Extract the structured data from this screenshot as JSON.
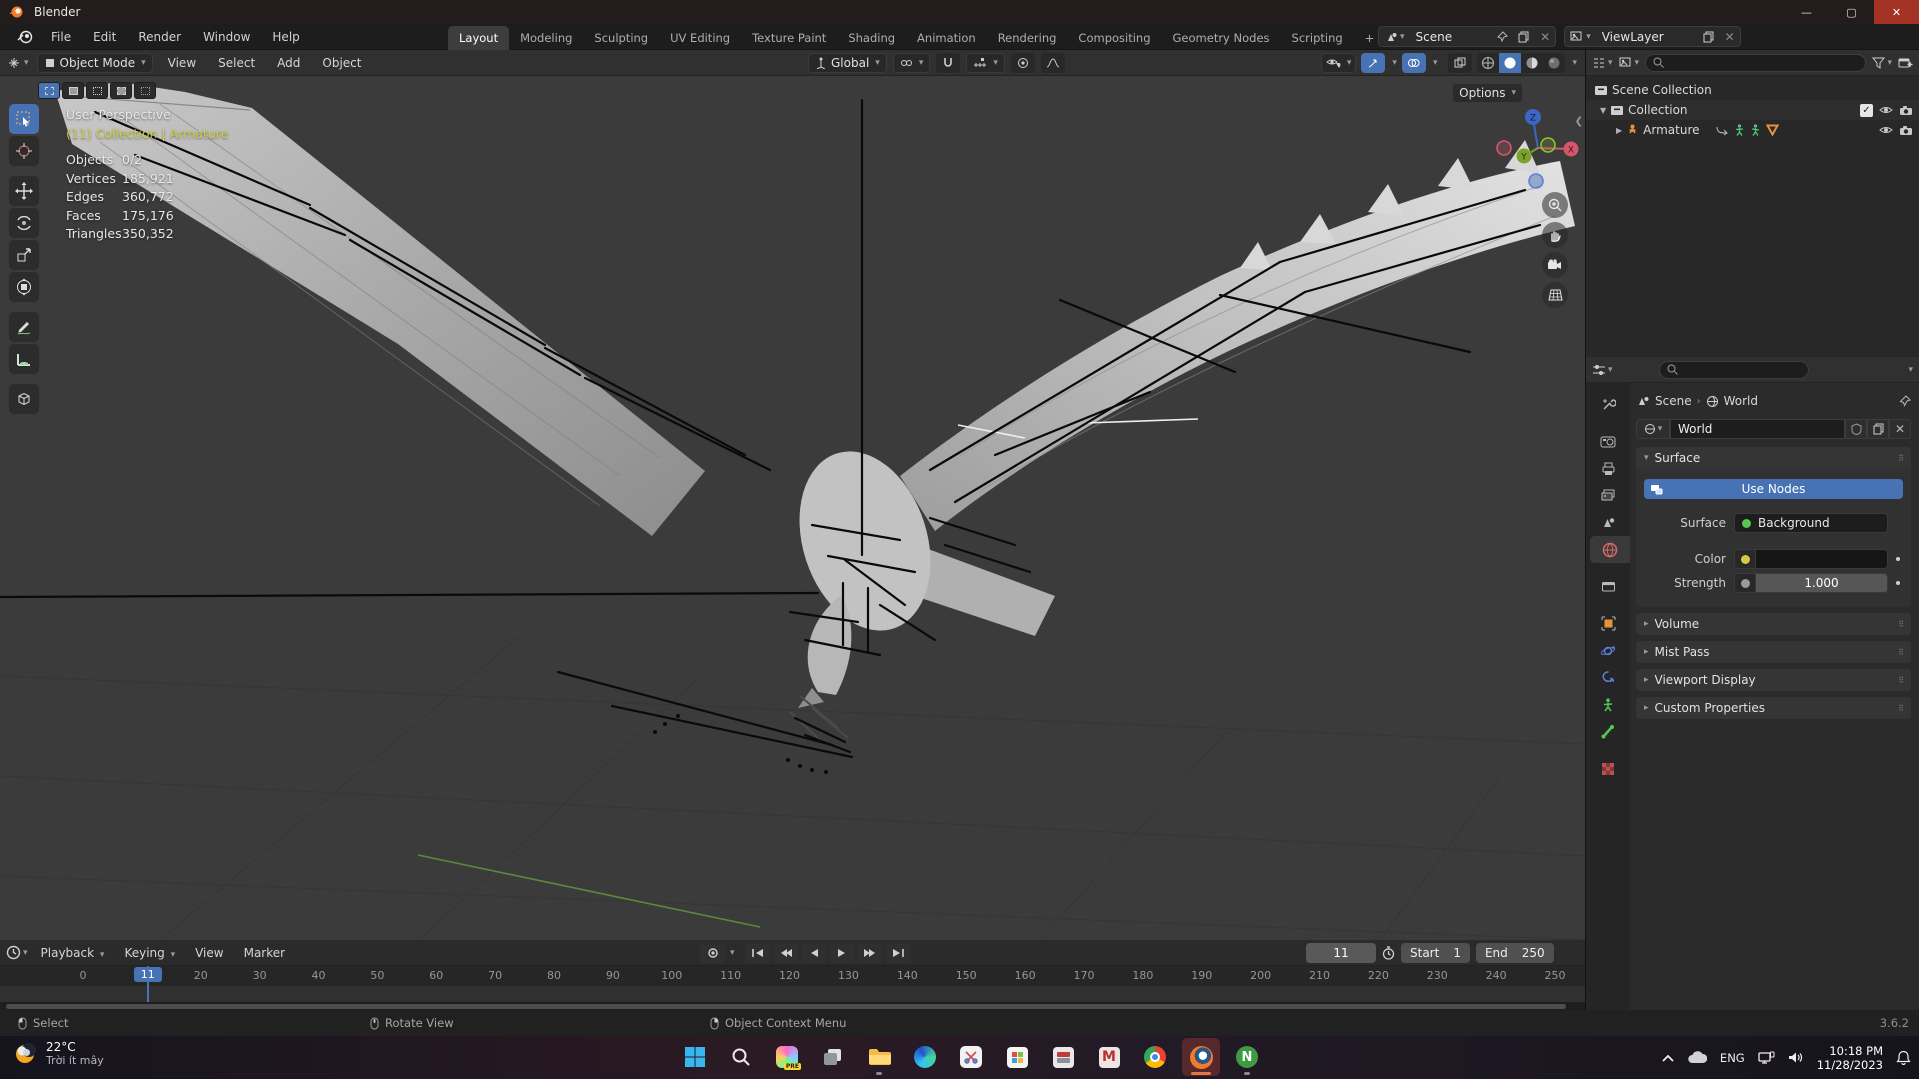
{
  "window": {
    "title": "Blender"
  },
  "topbar": {
    "menus": [
      "File",
      "Edit",
      "Render",
      "Window",
      "Help"
    ],
    "workspaces": [
      "Layout",
      "Modeling",
      "Sculpting",
      "UV Editing",
      "Texture Paint",
      "Shading",
      "Animation",
      "Rendering",
      "Compositing",
      "Geometry Nodes",
      "Scripting"
    ],
    "add_workspace": "+",
    "scene": "Scene",
    "view_layer": "ViewLayer"
  },
  "viewport": {
    "mode": "Object Mode",
    "menus": [
      "View",
      "Select",
      "Add",
      "Object"
    ],
    "orientation": "Global",
    "options": "Options",
    "overlay": {
      "view": "User Perspective",
      "context": "(11) Collection | Armature",
      "stats": [
        [
          "Objects",
          "0/2"
        ],
        [
          "Vertices",
          "185,921"
        ],
        [
          "Edges",
          "360,772"
        ],
        [
          "Faces",
          "175,176"
        ],
        [
          "Triangles",
          "350,352"
        ]
      ]
    },
    "gizmo": {
      "x": "X",
      "y": "Y",
      "z": "Z"
    }
  },
  "outliner": {
    "rows": [
      {
        "name": "Scene Collection"
      },
      {
        "name": "Collection"
      },
      {
        "name": "Armature"
      }
    ]
  },
  "properties": {
    "breadcrumb": {
      "scene": "Scene",
      "world": "World"
    },
    "datablock": "World",
    "surface_panel": "Surface",
    "use_nodes": "Use Nodes",
    "surface_label": "Surface",
    "surface_value": "Background",
    "color_label": "Color",
    "strength_label": "Strength",
    "strength_value": "1.000",
    "collapsed_panels": [
      "Volume",
      "Mist Pass",
      "Viewport Display",
      "Custom Properties"
    ]
  },
  "timeline": {
    "menus": [
      "Playback",
      "Keying",
      "View",
      "Marker"
    ],
    "current_frame": 11,
    "start_label": "Start",
    "start_value": "1",
    "end_label": "End",
    "end_value": "250",
    "ticks": [
      0,
      20,
      30,
      40,
      50,
      60,
      70,
      80,
      90,
      100,
      110,
      120,
      130,
      140,
      150,
      160,
      170,
      180,
      190,
      200,
      210,
      220,
      230,
      240,
      250
    ]
  },
  "status_bar": {
    "hints": [
      "Select",
      "Rotate View",
      "Object Context Menu"
    ],
    "version": "3.6.2"
  },
  "taskbar": {
    "weather_temp": "22°C",
    "weather_desc": "Trời ít mây",
    "language": "ENG",
    "time": "10:18 PM",
    "date": "11/28/2023"
  },
  "colors": {
    "accent": "#4772b3",
    "active_object": "#cfcf45",
    "axis_x": "#d5566c",
    "axis_y": "#7ba32c",
    "axis_z": "#3b66c4"
  }
}
